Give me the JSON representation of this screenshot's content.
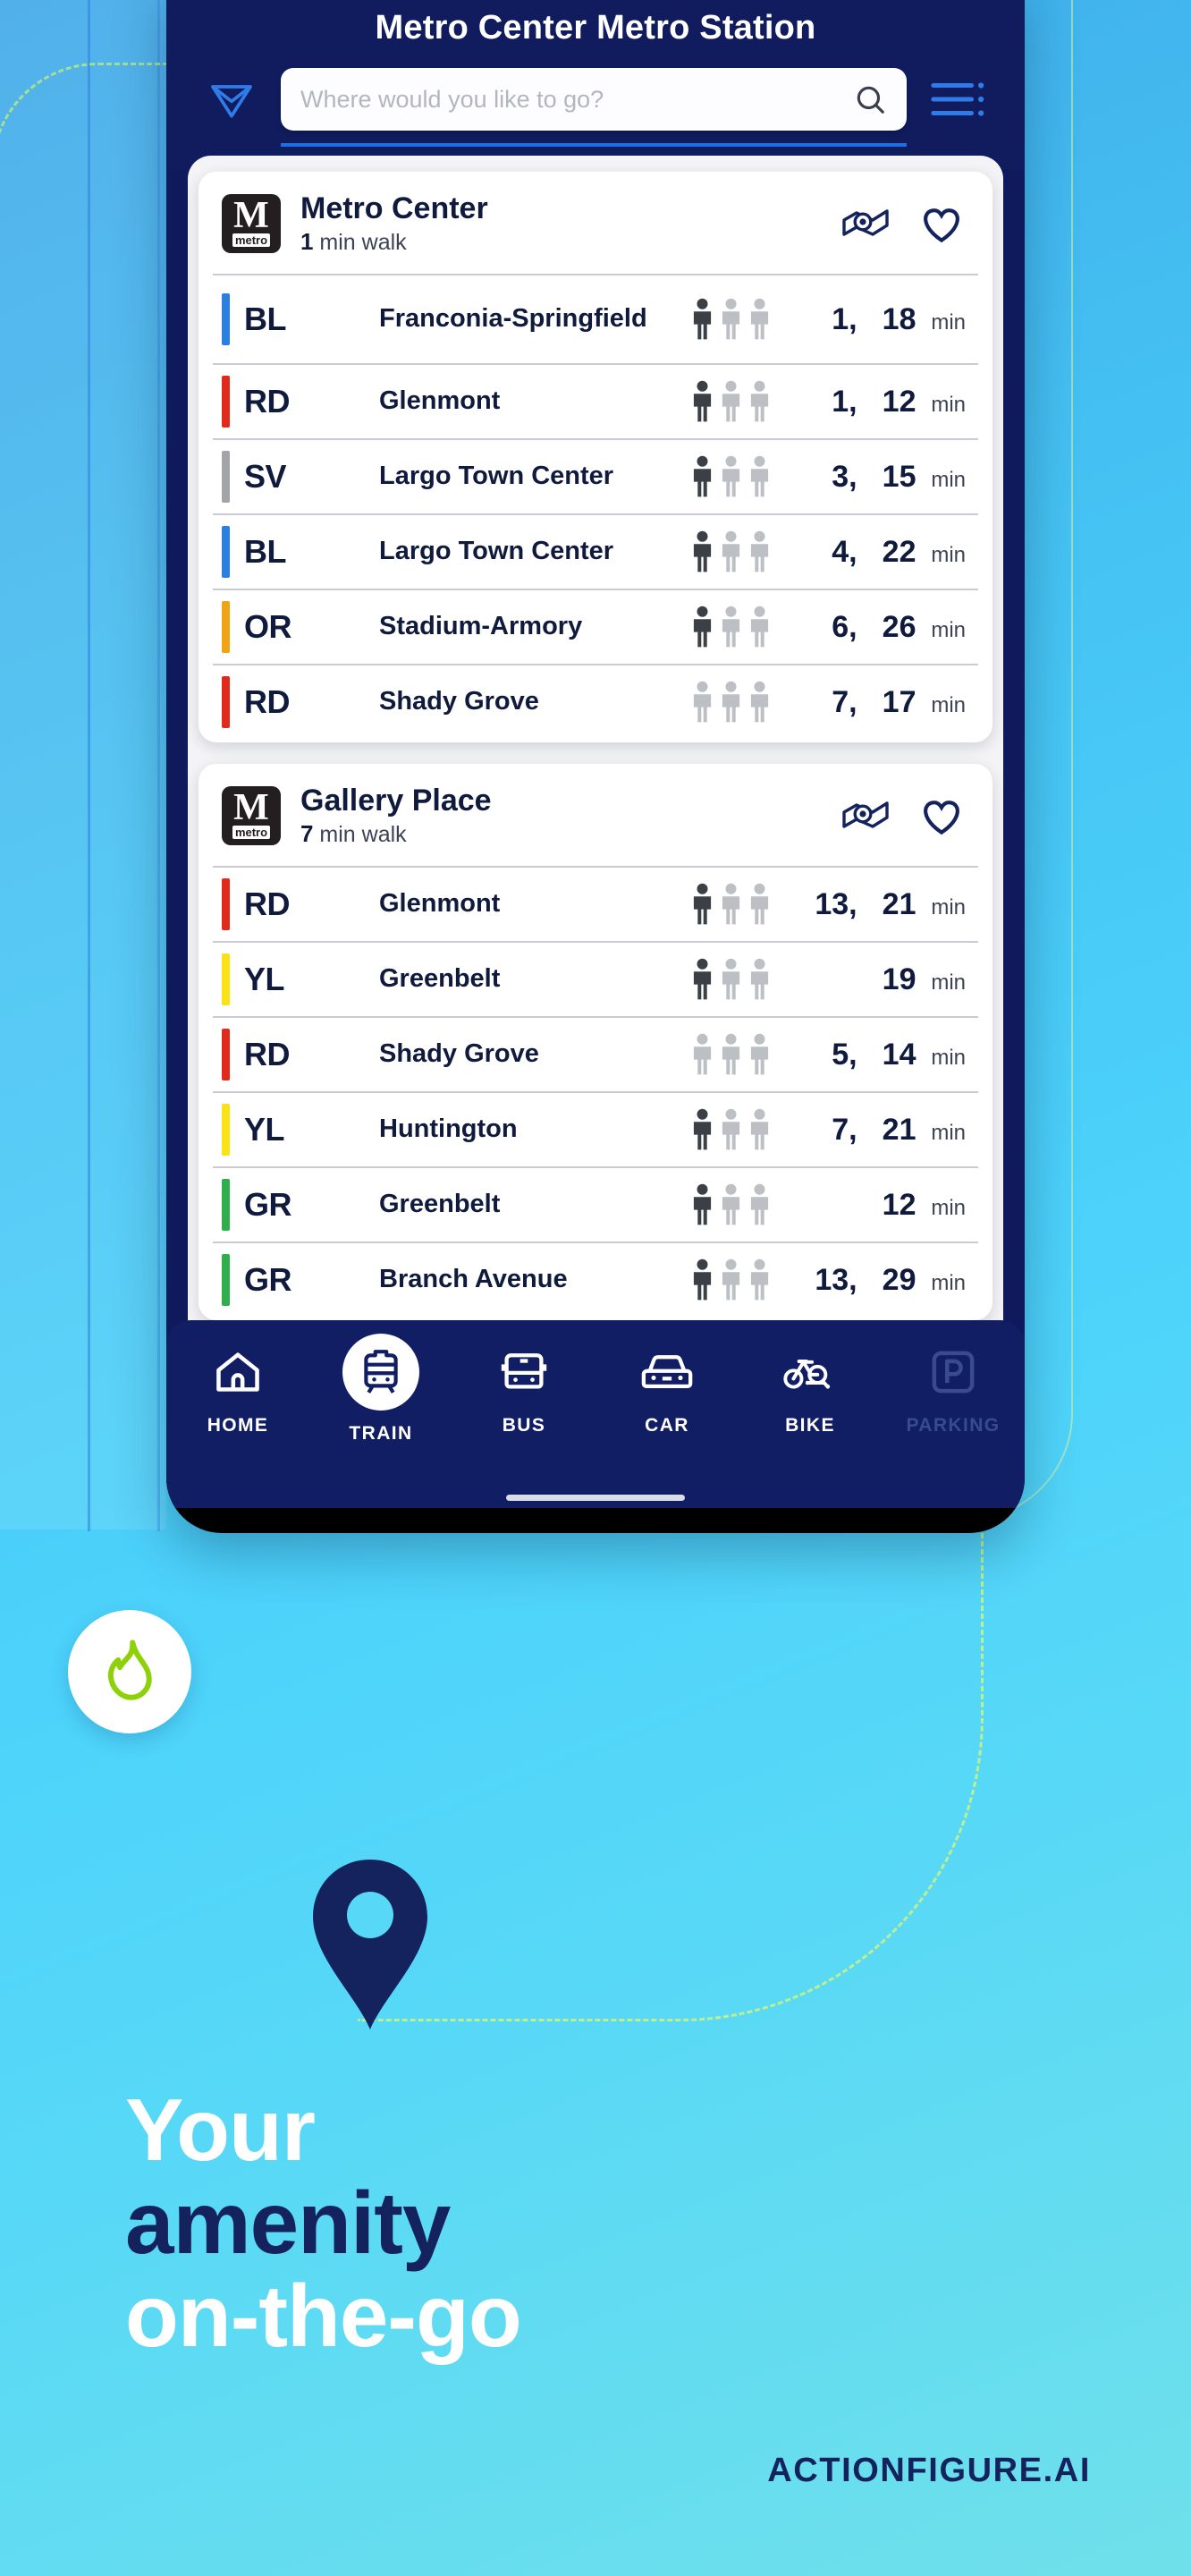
{
  "app": {
    "title": "Metro Center Metro Station",
    "search_placeholder": "Where would you like to go?",
    "search_value": ""
  },
  "icons": {
    "send": "send-icon",
    "search": "search-icon",
    "menu": "hamburger-menu-icon",
    "map": "map-pin-icon",
    "favorite": "heart-icon",
    "flame": "flame-icon",
    "pin": "location-pin-icon"
  },
  "colors": {
    "header_bg": "#101c5e",
    "nav_bg": "#111e63",
    "accent_blue": "#1f6fe0",
    "flame_green": "#8ed109",
    "line_BL": "#2b7fe0",
    "line_RD": "#e02b1c",
    "line_SV": "#a2a4a8",
    "line_OR": "#f0a415",
    "line_YL": "#fbe216",
    "line_GR": "#2fae4e",
    "brand_navy": "#14235e"
  },
  "cards": [
    {
      "badge_letter": "M",
      "badge_word": "metro",
      "name": "Metro Center",
      "walk_value": "1",
      "walk_unit": "min walk",
      "rows": [
        {
          "code": "BL",
          "color": "#2b7fe0",
          "destination": "Franconia-Springfield",
          "occupancy": [
            "dark",
            "light",
            "light"
          ],
          "first": "1,",
          "second": "18",
          "unit": "min"
        },
        {
          "code": "RD",
          "color": "#e02b1c",
          "destination": "Glenmont",
          "occupancy": [
            "dark",
            "light",
            "light"
          ],
          "first": "1,",
          "second": "12",
          "unit": "min"
        },
        {
          "code": "SV",
          "color": "#a2a4a8",
          "destination": "Largo Town Center",
          "occupancy": [
            "dark",
            "light",
            "light"
          ],
          "first": "3,",
          "second": "15",
          "unit": "min"
        },
        {
          "code": "BL",
          "color": "#2b7fe0",
          "destination": "Largo Town Center",
          "occupancy": [
            "dark",
            "light",
            "light"
          ],
          "first": "4,",
          "second": "22",
          "unit": "min"
        },
        {
          "code": "OR",
          "color": "#f0a415",
          "destination": "Stadium-Armory",
          "occupancy": [
            "dark",
            "light",
            "light"
          ],
          "first": "6,",
          "second": "26",
          "unit": "min"
        },
        {
          "code": "RD",
          "color": "#e02b1c",
          "destination": "Shady Grove",
          "occupancy": [
            "light",
            "light",
            "light"
          ],
          "first": "7,",
          "second": "17",
          "unit": "min"
        }
      ]
    },
    {
      "badge_letter": "M",
      "badge_word": "metro",
      "name": "Gallery Place",
      "walk_value": "7",
      "walk_unit": "min walk",
      "rows": [
        {
          "code": "RD",
          "color": "#e02b1c",
          "destination": "Glenmont",
          "occupancy": [
            "dark",
            "light",
            "light"
          ],
          "first": "13,",
          "second": "21",
          "unit": "min"
        },
        {
          "code": "YL",
          "color": "#fbe216",
          "destination": "Greenbelt",
          "occupancy": [
            "dark",
            "light",
            "light"
          ],
          "first": "",
          "second": "19",
          "unit": "min"
        },
        {
          "code": "RD",
          "color": "#e02b1c",
          "destination": "Shady Grove",
          "occupancy": [
            "light",
            "light",
            "light"
          ],
          "first": "5,",
          "second": "14",
          "unit": "min"
        },
        {
          "code": "YL",
          "color": "#fbe216",
          "destination": "Huntington",
          "occupancy": [
            "dark",
            "light",
            "light"
          ],
          "first": "7,",
          "second": "21",
          "unit": "min"
        },
        {
          "code": "GR",
          "color": "#2fae4e",
          "destination": "Greenbelt",
          "occupancy": [
            "dark",
            "light",
            "light"
          ],
          "first": "",
          "second": "12",
          "unit": "min"
        },
        {
          "code": "GR",
          "color": "#2fae4e",
          "destination": "Branch Avenue",
          "occupancy": [
            "dark",
            "light",
            "light"
          ],
          "first": "13,",
          "second": "29",
          "unit": "min"
        }
      ]
    }
  ],
  "bottom_nav": [
    {
      "label": "HOME",
      "icon": "home-icon",
      "active": false,
      "disabled": false
    },
    {
      "label": "TRAIN",
      "icon": "train-icon",
      "active": true,
      "disabled": false
    },
    {
      "label": "BUS",
      "icon": "bus-icon",
      "active": false,
      "disabled": false
    },
    {
      "label": "CAR",
      "icon": "car-icon",
      "active": false,
      "disabled": false
    },
    {
      "label": "BIKE",
      "icon": "bike-icon",
      "active": false,
      "disabled": false
    },
    {
      "label": "PARKING",
      "icon": "parking-icon",
      "active": false,
      "disabled": true
    }
  ],
  "marketing": {
    "line1": "Your",
    "line2": "amenity",
    "line3": "on-the-go",
    "brand": "ACTIONFIGURE.AI"
  }
}
